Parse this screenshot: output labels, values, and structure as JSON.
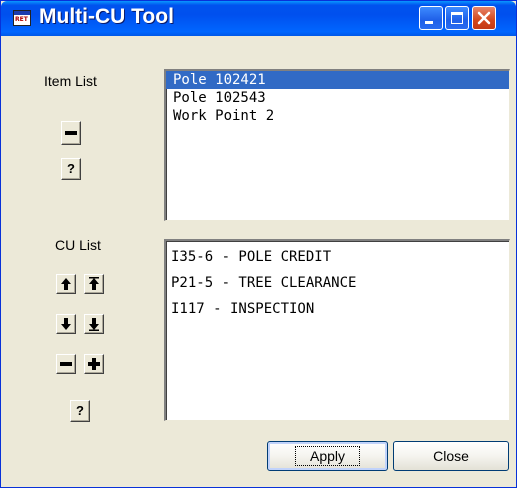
{
  "window": {
    "title": "Multi-CU Tool",
    "icon_text": "RET",
    "icon": "app-icon"
  },
  "item_section": {
    "label": "Item List",
    "remove_icon": "minus-icon",
    "help_label": "?",
    "items": [
      {
        "label": "Pole 102421",
        "selected": true
      },
      {
        "label": "Pole 102543",
        "selected": false
      },
      {
        "label": "Work Point 2",
        "selected": false
      }
    ]
  },
  "cu_section": {
    "label": "CU List",
    "help_label": "?",
    "items": [
      {
        "label": "I35-6 - POLE CREDIT"
      },
      {
        "label": "P21-5 - TREE CLEARANCE"
      },
      {
        "label": "I117 - INSPECTION"
      }
    ]
  },
  "footer": {
    "apply_label": "Apply",
    "close_label": "Close"
  },
  "colors": {
    "titlebar": "#0053ee",
    "selection": "#316ac5",
    "face": "#ece9d8",
    "close_button": "#d3471c"
  }
}
